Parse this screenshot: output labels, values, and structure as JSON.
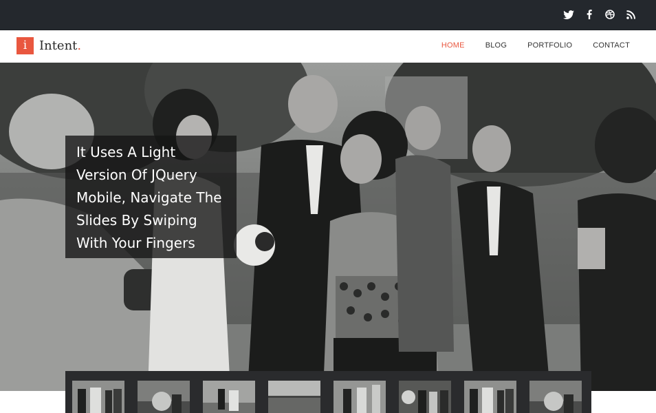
{
  "social": {
    "icons": [
      "twitter-icon",
      "facebook-icon",
      "dribbble-icon",
      "rss-icon"
    ]
  },
  "logo": {
    "mark": "i",
    "name": "Intent",
    "dot": "."
  },
  "nav": {
    "items": [
      "HOME",
      "BLOG",
      "PORTFOLIO",
      "CONTACT"
    ],
    "active": "HOME"
  },
  "slider": {
    "caption_lines": [
      "It Uses A Light",
      "Version Of JQuery",
      "Mobile, Navigate The",
      "Slides By Swiping",
      "With Your Fingers"
    ],
    "thumbnail_count": 8
  },
  "colors": {
    "accent": "#e9573f",
    "topbar": "#24282d",
    "thumbstrip": "#2a2b2d"
  }
}
